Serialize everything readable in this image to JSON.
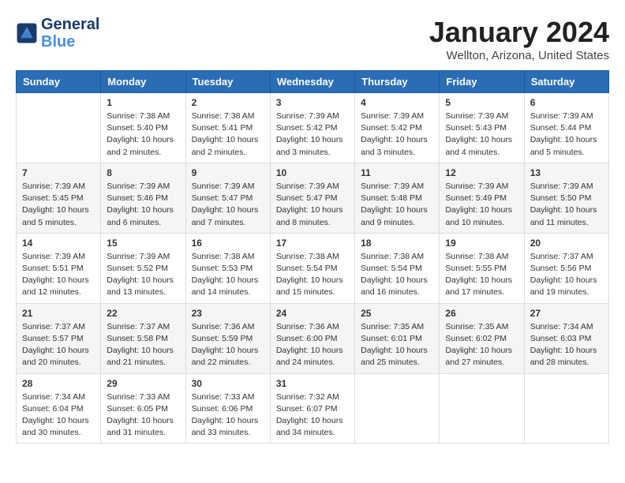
{
  "header": {
    "logo_line1": "General",
    "logo_line2": "Blue",
    "month": "January 2024",
    "location": "Wellton, Arizona, United States"
  },
  "weekdays": [
    "Sunday",
    "Monday",
    "Tuesday",
    "Wednesday",
    "Thursday",
    "Friday",
    "Saturday"
  ],
  "weeks": [
    [
      {
        "day": "",
        "info": ""
      },
      {
        "day": "1",
        "info": "Sunrise: 7:38 AM\nSunset: 5:40 PM\nDaylight: 10 hours\nand 2 minutes."
      },
      {
        "day": "2",
        "info": "Sunrise: 7:38 AM\nSunset: 5:41 PM\nDaylight: 10 hours\nand 2 minutes."
      },
      {
        "day": "3",
        "info": "Sunrise: 7:39 AM\nSunset: 5:42 PM\nDaylight: 10 hours\nand 3 minutes."
      },
      {
        "day": "4",
        "info": "Sunrise: 7:39 AM\nSunset: 5:42 PM\nDaylight: 10 hours\nand 3 minutes."
      },
      {
        "day": "5",
        "info": "Sunrise: 7:39 AM\nSunset: 5:43 PM\nDaylight: 10 hours\nand 4 minutes."
      },
      {
        "day": "6",
        "info": "Sunrise: 7:39 AM\nSunset: 5:44 PM\nDaylight: 10 hours\nand 5 minutes."
      }
    ],
    [
      {
        "day": "7",
        "info": "Sunrise: 7:39 AM\nSunset: 5:45 PM\nDaylight: 10 hours\nand 5 minutes."
      },
      {
        "day": "8",
        "info": "Sunrise: 7:39 AM\nSunset: 5:46 PM\nDaylight: 10 hours\nand 6 minutes."
      },
      {
        "day": "9",
        "info": "Sunrise: 7:39 AM\nSunset: 5:47 PM\nDaylight: 10 hours\nand 7 minutes."
      },
      {
        "day": "10",
        "info": "Sunrise: 7:39 AM\nSunset: 5:47 PM\nDaylight: 10 hours\nand 8 minutes."
      },
      {
        "day": "11",
        "info": "Sunrise: 7:39 AM\nSunset: 5:48 PM\nDaylight: 10 hours\nand 9 minutes."
      },
      {
        "day": "12",
        "info": "Sunrise: 7:39 AM\nSunset: 5:49 PM\nDaylight: 10 hours\nand 10 minutes."
      },
      {
        "day": "13",
        "info": "Sunrise: 7:39 AM\nSunset: 5:50 PM\nDaylight: 10 hours\nand 11 minutes."
      }
    ],
    [
      {
        "day": "14",
        "info": "Sunrise: 7:39 AM\nSunset: 5:51 PM\nDaylight: 10 hours\nand 12 minutes."
      },
      {
        "day": "15",
        "info": "Sunrise: 7:39 AM\nSunset: 5:52 PM\nDaylight: 10 hours\nand 13 minutes."
      },
      {
        "day": "16",
        "info": "Sunrise: 7:38 AM\nSunset: 5:53 PM\nDaylight: 10 hours\nand 14 minutes."
      },
      {
        "day": "17",
        "info": "Sunrise: 7:38 AM\nSunset: 5:54 PM\nDaylight: 10 hours\nand 15 minutes."
      },
      {
        "day": "18",
        "info": "Sunrise: 7:38 AM\nSunset: 5:54 PM\nDaylight: 10 hours\nand 16 minutes."
      },
      {
        "day": "19",
        "info": "Sunrise: 7:38 AM\nSunset: 5:55 PM\nDaylight: 10 hours\nand 17 minutes."
      },
      {
        "day": "20",
        "info": "Sunrise: 7:37 AM\nSunset: 5:56 PM\nDaylight: 10 hours\nand 19 minutes."
      }
    ],
    [
      {
        "day": "21",
        "info": "Sunrise: 7:37 AM\nSunset: 5:57 PM\nDaylight: 10 hours\nand 20 minutes."
      },
      {
        "day": "22",
        "info": "Sunrise: 7:37 AM\nSunset: 5:58 PM\nDaylight: 10 hours\nand 21 minutes."
      },
      {
        "day": "23",
        "info": "Sunrise: 7:36 AM\nSunset: 5:59 PM\nDaylight: 10 hours\nand 22 minutes."
      },
      {
        "day": "24",
        "info": "Sunrise: 7:36 AM\nSunset: 6:00 PM\nDaylight: 10 hours\nand 24 minutes."
      },
      {
        "day": "25",
        "info": "Sunrise: 7:35 AM\nSunset: 6:01 PM\nDaylight: 10 hours\nand 25 minutes."
      },
      {
        "day": "26",
        "info": "Sunrise: 7:35 AM\nSunset: 6:02 PM\nDaylight: 10 hours\nand 27 minutes."
      },
      {
        "day": "27",
        "info": "Sunrise: 7:34 AM\nSunset: 6:03 PM\nDaylight: 10 hours\nand 28 minutes."
      }
    ],
    [
      {
        "day": "28",
        "info": "Sunrise: 7:34 AM\nSunset: 6:04 PM\nDaylight: 10 hours\nand 30 minutes."
      },
      {
        "day": "29",
        "info": "Sunrise: 7:33 AM\nSunset: 6:05 PM\nDaylight: 10 hours\nand 31 minutes."
      },
      {
        "day": "30",
        "info": "Sunrise: 7:33 AM\nSunset: 6:06 PM\nDaylight: 10 hours\nand 33 minutes."
      },
      {
        "day": "31",
        "info": "Sunrise: 7:32 AM\nSunset: 6:07 PM\nDaylight: 10 hours\nand 34 minutes."
      },
      {
        "day": "",
        "info": ""
      },
      {
        "day": "",
        "info": ""
      },
      {
        "day": "",
        "info": ""
      }
    ]
  ]
}
